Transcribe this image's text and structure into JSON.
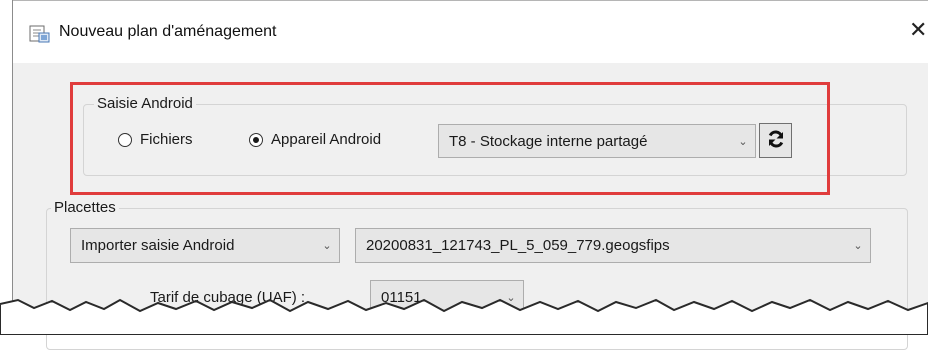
{
  "window": {
    "title": "Nouveau plan d'aménagement",
    "icon": "document-window-icon",
    "close_glyph": "✕"
  },
  "android_group": {
    "legend": "Saisie Android",
    "radio_files": {
      "label": "Fichiers",
      "checked": false
    },
    "radio_device": {
      "label": "Appareil Android",
      "checked": true
    },
    "device_select": {
      "value": "T8 - Stockage interne partagé"
    },
    "refresh_icon": "refresh-icon",
    "highlight_color": "#e03c3c"
  },
  "placettes_group": {
    "legend": "Placettes",
    "import_select": {
      "value": "Importer saisie Android"
    },
    "file_select": {
      "value": "20200831_121743_PL_5_059_779.geogsfips"
    },
    "tarif_label": "Tarif de cubage (UAF) :",
    "tarif_select": {
      "value": "01151"
    }
  }
}
